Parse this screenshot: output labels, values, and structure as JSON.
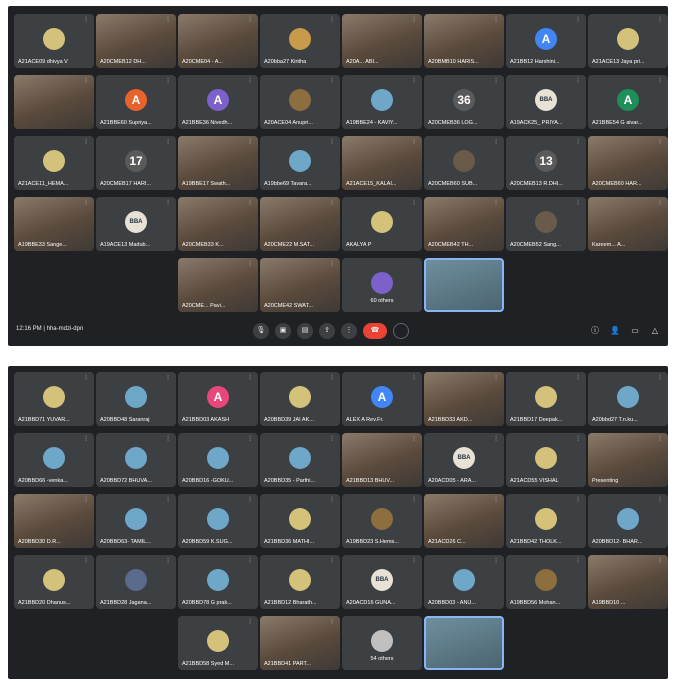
{
  "panel1": {
    "tiles": [
      {
        "name": "A21ACE09 dhivya V",
        "kind": "avatar",
        "initial": "",
        "avatar_color": "#d4c17a"
      },
      {
        "name": "A20CMEB12 DH...",
        "kind": "cam",
        "initial": ""
      },
      {
        "name": "A20CME04 - A...",
        "kind": "cam",
        "initial": ""
      },
      {
        "name": "A20bba27 Kiritha",
        "kind": "avatar",
        "initial": "",
        "avatar_color": "#c99a4a"
      },
      {
        "name": "A20A... ABI...",
        "kind": "cam",
        "initial": ""
      },
      {
        "name": "A20BMB10 HARIS...",
        "kind": "cam",
        "initial": ""
      },
      {
        "name": "A21BB12 Harshini...",
        "kind": "avatar",
        "initial": "A",
        "avatar_color": "#4285f4"
      },
      {
        "name": "A21ACE13 Jaya pri...",
        "kind": "avatar",
        "initial": "",
        "avatar_color": "#d4c17a"
      },
      {
        "name": "",
        "kind": "cam",
        "initial": ""
      },
      {
        "name": "A21BBE60 Supriya...",
        "kind": "avatar",
        "initial": "A",
        "avatar_color": "#e8622c"
      },
      {
        "name": "A21BBE36 Nivedh...",
        "kind": "avatar",
        "initial": "A",
        "avatar_color": "#7b61c9"
      },
      {
        "name": "A20ACE04 Anupri...",
        "kind": "avatar",
        "initial": "",
        "avatar_color": "#8d6e3f"
      },
      {
        "name": "A19BBE24 - KAVIY...",
        "kind": "avatar",
        "initial": "",
        "avatar_color": "#6fa7c9"
      },
      {
        "name": "A20CMEB36 LOG...",
        "kind": "avatar",
        "initial": "36",
        "avatar_color": "#5a5a5a"
      },
      {
        "name": "A19ACK25_ PRIYA...",
        "kind": "avatar",
        "initial": "BBA",
        "avatar_color": "#e7e2d4"
      },
      {
        "name": "A21BBE54 G aivar...",
        "kind": "avatar",
        "initial": "A",
        "avatar_color": "#1e8e5a"
      },
      {
        "name": "A21ACE11_HEMA...",
        "kind": "avatar",
        "initial": "",
        "avatar_color": "#d4c17a"
      },
      {
        "name": "A20CMEB17 HARI...",
        "kind": "avatar",
        "initial": "17",
        "avatar_color": "#5a5a5a"
      },
      {
        "name": "A19BBE17 Swath...",
        "kind": "cam",
        "initial": ""
      },
      {
        "name": "A19bbe69 Tavara...",
        "kind": "avatar",
        "initial": "",
        "avatar_color": "#6fa7c9"
      },
      {
        "name": "A21ACE15_KALAI...",
        "kind": "cam",
        "initial": ""
      },
      {
        "name": "A20CMEB60 SUB...",
        "kind": "avatar",
        "initial": "",
        "avatar_color": "#6a5a4a"
      },
      {
        "name": "A20CMEB13 R.DHI...",
        "kind": "avatar",
        "initial": "13",
        "avatar_color": "#5a5a5a"
      },
      {
        "name": "A20CMEB60 HAR...",
        "kind": "cam",
        "initial": ""
      },
      {
        "name": "A19BBE33 Sange...",
        "kind": "cam",
        "initial": ""
      },
      {
        "name": "A19ACE13 Madub...",
        "kind": "avatar",
        "initial": "BBA",
        "avatar_color": "#e7e2d4"
      },
      {
        "name": "A20CMEB33 K...",
        "kind": "cam",
        "initial": ""
      },
      {
        "name": "A20CME22 M.SAT...",
        "kind": "cam",
        "initial": ""
      },
      {
        "name": "AKALYA P",
        "kind": "avatar",
        "initial": "",
        "avatar_color": "#d4c17a"
      },
      {
        "name": "A20CMEB42 TH...",
        "kind": "cam",
        "initial": ""
      },
      {
        "name": "A20CMEB52 Sang...",
        "kind": "avatar",
        "initial": "",
        "avatar_color": "#6a5a4a"
      },
      {
        "name": "Kareem... A...",
        "kind": "cam",
        "initial": ""
      },
      {
        "name": "A20CME... Pavi...",
        "kind": "cam",
        "initial": ""
      },
      {
        "name": "A20CME42 SWAT...",
        "kind": "cam",
        "initial": ""
      },
      {
        "name": "60 others",
        "kind": "others",
        "initial": "",
        "avatar_color": "#7b61c9"
      },
      {
        "name": "",
        "kind": "self",
        "initial": ""
      }
    ],
    "time": "12:16 PM",
    "meeting_code": "hha-mdzi-dpn"
  },
  "panel2": {
    "tiles": [
      {
        "name": "A21BBD71 YUVAR...",
        "kind": "avatar",
        "initial": "",
        "avatar_color": "#d4c17a"
      },
      {
        "name": "A20BBD48 Saranraj",
        "kind": "avatar",
        "initial": "",
        "avatar_color": "#6fa7c9"
      },
      {
        "name": "A21BBD03 AKASH",
        "kind": "avatar",
        "initial": "A",
        "avatar_color": "#e8477a"
      },
      {
        "name": "A20BBD39 JAI AK...",
        "kind": "avatar",
        "initial": "",
        "avatar_color": "#d4c17a"
      },
      {
        "name": "ALEX A Rev.Fr.",
        "kind": "avatar",
        "initial": "A",
        "avatar_color": "#4285f4"
      },
      {
        "name": "A21BBD33 AKD...",
        "kind": "cam",
        "initial": ""
      },
      {
        "name": "A21BBD17 Deepak...",
        "kind": "avatar",
        "initial": "",
        "avatar_color": "#d4c17a"
      },
      {
        "name": "A20bbd27 T.n.ku...",
        "kind": "avatar",
        "initial": "",
        "avatar_color": "#6fa7c9"
      },
      {
        "name": "A20BBD66 -venka...",
        "kind": "avatar",
        "initial": "",
        "avatar_color": "#6fa7c9"
      },
      {
        "name": "A20BBD72 BHUVA...",
        "kind": "avatar",
        "initial": "",
        "avatar_color": "#6fa7c9"
      },
      {
        "name": "A20BBD16 -GOKU...",
        "kind": "avatar",
        "initial": "",
        "avatar_color": "#6fa7c9"
      },
      {
        "name": "A20BBD35 - Parthi...",
        "kind": "avatar",
        "initial": "",
        "avatar_color": "#6fa7c9"
      },
      {
        "name": "A21BBD13 BHUV...",
        "kind": "cam",
        "initial": ""
      },
      {
        "name": "A20ACD05 - ARA...",
        "kind": "avatar",
        "initial": "BBA",
        "avatar_color": "#e7e2d4"
      },
      {
        "name": "A21ACD55 VISHAL",
        "kind": "avatar",
        "initial": "",
        "avatar_color": "#d4c17a"
      },
      {
        "name": "Presenting",
        "kind": "cam",
        "initial": ""
      },
      {
        "name": "A20BBD30 D.R...",
        "kind": "cam",
        "initial": ""
      },
      {
        "name": "A20BBD63- TAMIL...",
        "kind": "avatar",
        "initial": "",
        "avatar_color": "#6fa7c9"
      },
      {
        "name": "A20BBD59 K.SUG...",
        "kind": "avatar",
        "initial": "",
        "avatar_color": "#6fa7c9"
      },
      {
        "name": "A21BBD36 MATHI...",
        "kind": "avatar",
        "initial": "",
        "avatar_color": "#d4c17a"
      },
      {
        "name": "A19BBD23 S.Hems...",
        "kind": "avatar",
        "initial": "",
        "avatar_color": "#8d6e3f"
      },
      {
        "name": "A21ACD26 C...",
        "kind": "cam",
        "initial": ""
      },
      {
        "name": "A21BBD42 THOLK...",
        "kind": "avatar",
        "initial": "",
        "avatar_color": "#d4c17a"
      },
      {
        "name": "A20BBD12- BHAR...",
        "kind": "avatar",
        "initial": "",
        "avatar_color": "#6fa7c9"
      },
      {
        "name": "A21BBD20 Dhanus...",
        "kind": "avatar",
        "initial": "",
        "avatar_color": "#d4c17a"
      },
      {
        "name": "A21BBD28 Jagana...",
        "kind": "avatar",
        "initial": "",
        "avatar_color": "#5a6a8a"
      },
      {
        "name": "A20BBD78 G prak...",
        "kind": "avatar",
        "initial": "",
        "avatar_color": "#6fa7c9"
      },
      {
        "name": "A21BBD12 Bharath...",
        "kind": "avatar",
        "initial": "",
        "avatar_color": "#d4c17a"
      },
      {
        "name": "A20ACD16 GUNA...",
        "kind": "avatar",
        "initial": "BBA",
        "avatar_color": "#e7e2d4"
      },
      {
        "name": "A20BBD03 - ANU...",
        "kind": "avatar",
        "initial": "",
        "avatar_color": "#6fa7c9"
      },
      {
        "name": "A19BBD56 Mohan...",
        "kind": "avatar",
        "initial": "",
        "avatar_color": "#8d6e3f"
      },
      {
        "name": "A19BBD10 ...",
        "kind": "cam",
        "initial": ""
      },
      {
        "name": "A21BBD58 Syed M...",
        "kind": "avatar",
        "initial": "",
        "avatar_color": "#d4c17a"
      },
      {
        "name": "A21BBD41 PART...",
        "kind": "cam",
        "initial": ""
      },
      {
        "name": "54 others",
        "kind": "others",
        "initial": "",
        "avatar_color": "#c0c0c0"
      },
      {
        "name": "",
        "kind": "self",
        "initial": ""
      }
    ]
  },
  "icons": {
    "mic": "mic-icon",
    "cam": "camera-icon",
    "cc": "captions-icon",
    "present": "present-icon",
    "more": "more-icon",
    "end": "end-call-icon",
    "hand": "raise-hand-icon",
    "info": "info-icon",
    "people": "people-icon",
    "chat": "chat-icon",
    "activities": "activities-icon"
  }
}
